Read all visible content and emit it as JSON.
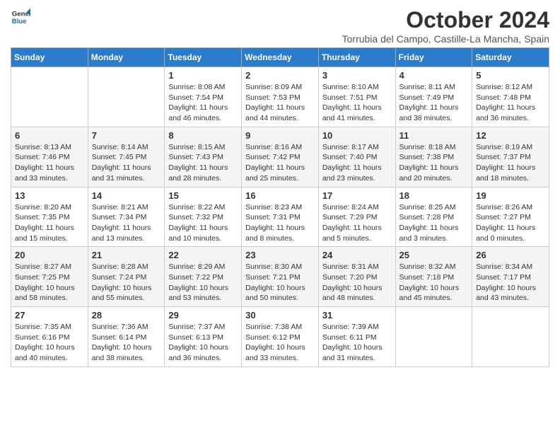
{
  "header": {
    "logo_line1": "General",
    "logo_line2": "Blue",
    "month_title": "October 2024",
    "subtitle": "Torrubia del Campo, Castille-La Mancha, Spain"
  },
  "weekdays": [
    "Sunday",
    "Monday",
    "Tuesday",
    "Wednesday",
    "Thursday",
    "Friday",
    "Saturday"
  ],
  "weeks": [
    [
      {
        "day": "",
        "sunrise": "",
        "sunset": "",
        "daylight": ""
      },
      {
        "day": "",
        "sunrise": "",
        "sunset": "",
        "daylight": ""
      },
      {
        "day": "1",
        "sunrise": "Sunrise: 8:08 AM",
        "sunset": "Sunset: 7:54 PM",
        "daylight": "Daylight: 11 hours and 46 minutes."
      },
      {
        "day": "2",
        "sunrise": "Sunrise: 8:09 AM",
        "sunset": "Sunset: 7:53 PM",
        "daylight": "Daylight: 11 hours and 44 minutes."
      },
      {
        "day": "3",
        "sunrise": "Sunrise: 8:10 AM",
        "sunset": "Sunset: 7:51 PM",
        "daylight": "Daylight: 11 hours and 41 minutes."
      },
      {
        "day": "4",
        "sunrise": "Sunrise: 8:11 AM",
        "sunset": "Sunset: 7:49 PM",
        "daylight": "Daylight: 11 hours and 38 minutes."
      },
      {
        "day": "5",
        "sunrise": "Sunrise: 8:12 AM",
        "sunset": "Sunset: 7:48 PM",
        "daylight": "Daylight: 11 hours and 36 minutes."
      }
    ],
    [
      {
        "day": "6",
        "sunrise": "Sunrise: 8:13 AM",
        "sunset": "Sunset: 7:46 PM",
        "daylight": "Daylight: 11 hours and 33 minutes."
      },
      {
        "day": "7",
        "sunrise": "Sunrise: 8:14 AM",
        "sunset": "Sunset: 7:45 PM",
        "daylight": "Daylight: 11 hours and 31 minutes."
      },
      {
        "day": "8",
        "sunrise": "Sunrise: 8:15 AM",
        "sunset": "Sunset: 7:43 PM",
        "daylight": "Daylight: 11 hours and 28 minutes."
      },
      {
        "day": "9",
        "sunrise": "Sunrise: 8:16 AM",
        "sunset": "Sunset: 7:42 PM",
        "daylight": "Daylight: 11 hours and 25 minutes."
      },
      {
        "day": "10",
        "sunrise": "Sunrise: 8:17 AM",
        "sunset": "Sunset: 7:40 PM",
        "daylight": "Daylight: 11 hours and 23 minutes."
      },
      {
        "day": "11",
        "sunrise": "Sunrise: 8:18 AM",
        "sunset": "Sunset: 7:38 PM",
        "daylight": "Daylight: 11 hours and 20 minutes."
      },
      {
        "day": "12",
        "sunrise": "Sunrise: 8:19 AM",
        "sunset": "Sunset: 7:37 PM",
        "daylight": "Daylight: 11 hours and 18 minutes."
      }
    ],
    [
      {
        "day": "13",
        "sunrise": "Sunrise: 8:20 AM",
        "sunset": "Sunset: 7:35 PM",
        "daylight": "Daylight: 11 hours and 15 minutes."
      },
      {
        "day": "14",
        "sunrise": "Sunrise: 8:21 AM",
        "sunset": "Sunset: 7:34 PM",
        "daylight": "Daylight: 11 hours and 13 minutes."
      },
      {
        "day": "15",
        "sunrise": "Sunrise: 8:22 AM",
        "sunset": "Sunset: 7:32 PM",
        "daylight": "Daylight: 11 hours and 10 minutes."
      },
      {
        "day": "16",
        "sunrise": "Sunrise: 8:23 AM",
        "sunset": "Sunset: 7:31 PM",
        "daylight": "Daylight: 11 hours and 8 minutes."
      },
      {
        "day": "17",
        "sunrise": "Sunrise: 8:24 AM",
        "sunset": "Sunset: 7:29 PM",
        "daylight": "Daylight: 11 hours and 5 minutes."
      },
      {
        "day": "18",
        "sunrise": "Sunrise: 8:25 AM",
        "sunset": "Sunset: 7:28 PM",
        "daylight": "Daylight: 11 hours and 3 minutes."
      },
      {
        "day": "19",
        "sunrise": "Sunrise: 8:26 AM",
        "sunset": "Sunset: 7:27 PM",
        "daylight": "Daylight: 11 hours and 0 minutes."
      }
    ],
    [
      {
        "day": "20",
        "sunrise": "Sunrise: 8:27 AM",
        "sunset": "Sunset: 7:25 PM",
        "daylight": "Daylight: 10 hours and 58 minutes."
      },
      {
        "day": "21",
        "sunrise": "Sunrise: 8:28 AM",
        "sunset": "Sunset: 7:24 PM",
        "daylight": "Daylight: 10 hours and 55 minutes."
      },
      {
        "day": "22",
        "sunrise": "Sunrise: 8:29 AM",
        "sunset": "Sunset: 7:22 PM",
        "daylight": "Daylight: 10 hours and 53 minutes."
      },
      {
        "day": "23",
        "sunrise": "Sunrise: 8:30 AM",
        "sunset": "Sunset: 7:21 PM",
        "daylight": "Daylight: 10 hours and 50 minutes."
      },
      {
        "day": "24",
        "sunrise": "Sunrise: 8:31 AM",
        "sunset": "Sunset: 7:20 PM",
        "daylight": "Daylight: 10 hours and 48 minutes."
      },
      {
        "day": "25",
        "sunrise": "Sunrise: 8:32 AM",
        "sunset": "Sunset: 7:18 PM",
        "daylight": "Daylight: 10 hours and 45 minutes."
      },
      {
        "day": "26",
        "sunrise": "Sunrise: 8:34 AM",
        "sunset": "Sunset: 7:17 PM",
        "daylight": "Daylight: 10 hours and 43 minutes."
      }
    ],
    [
      {
        "day": "27",
        "sunrise": "Sunrise: 7:35 AM",
        "sunset": "Sunset: 6:16 PM",
        "daylight": "Daylight: 10 hours and 40 minutes."
      },
      {
        "day": "28",
        "sunrise": "Sunrise: 7:36 AM",
        "sunset": "Sunset: 6:14 PM",
        "daylight": "Daylight: 10 hours and 38 minutes."
      },
      {
        "day": "29",
        "sunrise": "Sunrise: 7:37 AM",
        "sunset": "Sunset: 6:13 PM",
        "daylight": "Daylight: 10 hours and 36 minutes."
      },
      {
        "day": "30",
        "sunrise": "Sunrise: 7:38 AM",
        "sunset": "Sunset: 6:12 PM",
        "daylight": "Daylight: 10 hours and 33 minutes."
      },
      {
        "day": "31",
        "sunrise": "Sunrise: 7:39 AM",
        "sunset": "Sunset: 6:11 PM",
        "daylight": "Daylight: 10 hours and 31 minutes."
      },
      {
        "day": "",
        "sunrise": "",
        "sunset": "",
        "daylight": ""
      },
      {
        "day": "",
        "sunrise": "",
        "sunset": "",
        "daylight": ""
      }
    ]
  ]
}
